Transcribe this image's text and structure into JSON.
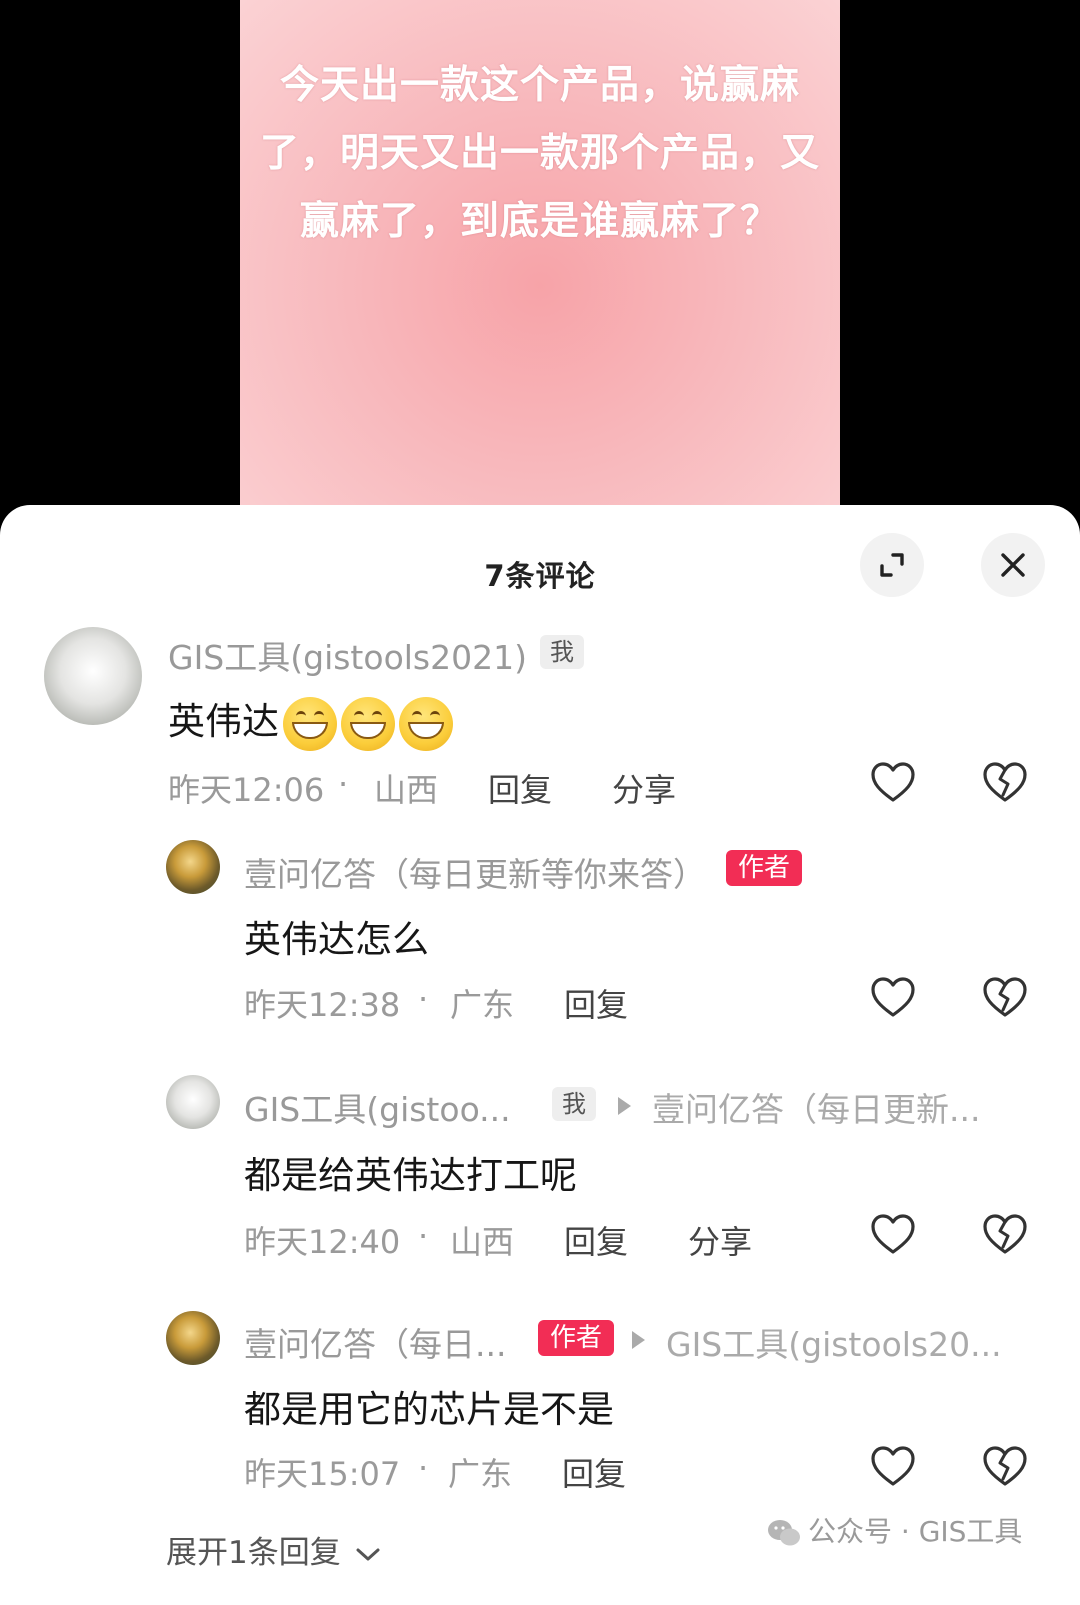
{
  "video": {
    "caption": "今天出一款这个产品，说赢麻了，明天又出一款那个产品，又赢麻了，到底是谁赢麻了？"
  },
  "sheet": {
    "title": "7条评论"
  },
  "comments": [
    {
      "username": "GIS工具(gistools2021)",
      "badge": "我",
      "content": "英伟达",
      "emoji_count": 3,
      "time": "昨天12:06",
      "location": "山西",
      "reply_label": "回复",
      "share_label": "分享"
    },
    {
      "username": "壹问亿答（每日更新等你来答）",
      "badge": "作者",
      "content": "英伟达怎么",
      "time": "昨天12:38",
      "location": "广东",
      "reply_label": "回复"
    },
    {
      "username": "GIS工具(gistoo...",
      "badge": "我",
      "reply_to": "壹问亿答（每日更新...",
      "content": "都是给英伟达打工呢",
      "time": "昨天12:40",
      "location": "山西",
      "reply_label": "回复",
      "share_label": "分享"
    },
    {
      "username": "壹问亿答（每日...",
      "badge": "作者",
      "reply_to": "GIS工具(gistools20...",
      "content": "都是用它的芯片是不是",
      "time": "昨天15:07",
      "location": "广东",
      "reply_label": "回复"
    }
  ],
  "expand_more": "展开1条回复",
  "watermark": "公众号 · GIS工具",
  "icons": {
    "expand": "fullscreen-icon",
    "close": "close-icon",
    "like": "heart-icon",
    "dislike": "broken-heart-icon"
  },
  "colors": {
    "author_badge": "#f22d55",
    "video_bg": "#f8b8bc"
  }
}
